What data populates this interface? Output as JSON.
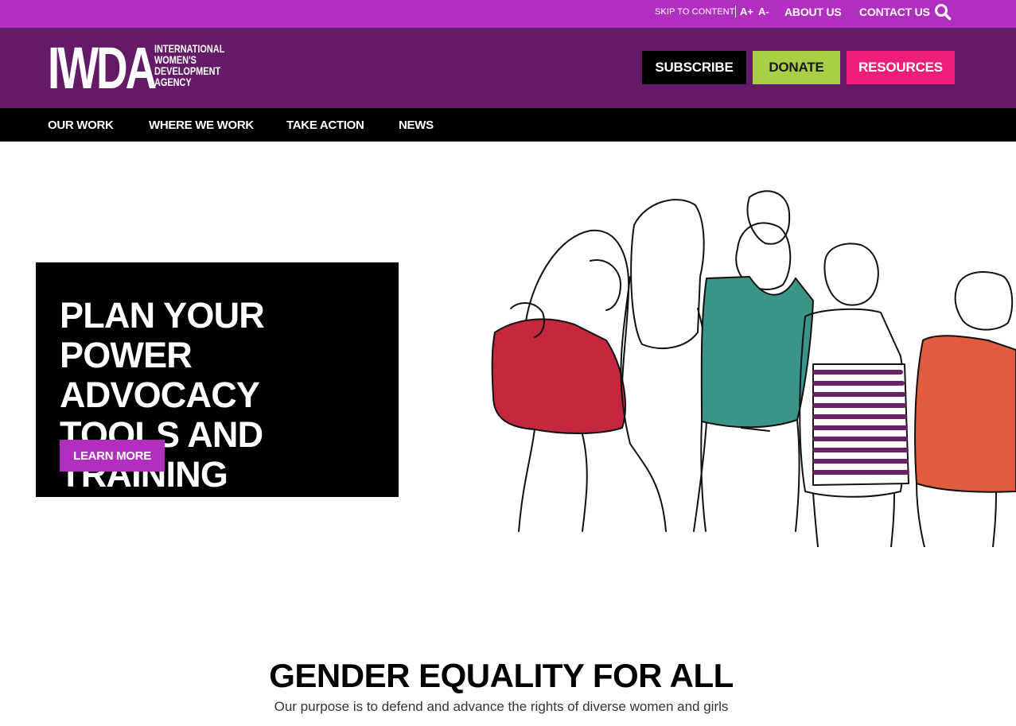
{
  "utility_bar": {
    "skip_label": "SKIP TO CONTENT",
    "font_increase": "A+",
    "font_decrease": "A-",
    "about": "ABOUT US",
    "contact": "CONTACT US",
    "search_icon": "search-icon"
  },
  "header": {
    "logo_mark": "IWDA",
    "logo_lines": [
      "INTERNATIONAL",
      "WOMEN'S",
      "DEVELOPMENT",
      "AGENCY"
    ],
    "buttons": {
      "subscribe": "SUBSCRIBE",
      "donate": "DONATE",
      "resources": "RESOURCES"
    }
  },
  "nav": {
    "items": [
      "OUR WORK",
      "WHERE WE WORK",
      "TAKE ACTION",
      "NEWS"
    ]
  },
  "hero": {
    "title": "PLAN YOUR POWER ADVOCACY TOOLS AND TRAINING",
    "button": "LEARN MORE"
  },
  "intro": {
    "heading": "GENDER EQUALITY FOR ALL",
    "subheading": "Our purpose is to defend and advance the rights of diverse women and girls"
  },
  "colors": {
    "utility_bar": "#b02fbf",
    "header": "#641a66",
    "nav": "#000000",
    "donate": "#a8cf45",
    "resources": "#ed1e79",
    "learn_more": "#b02fbf"
  }
}
